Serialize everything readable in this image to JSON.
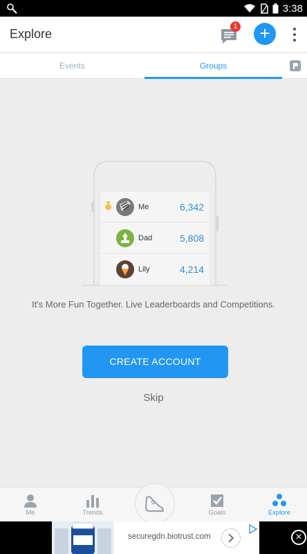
{
  "statusbar": {
    "time": "3:38"
  },
  "appbar": {
    "title": "Explore",
    "message_badge": "1",
    "add_label": "+"
  },
  "tabs": [
    {
      "label": "Events"
    },
    {
      "label": "Groups"
    }
  ],
  "illustration": {
    "leaderboard": [
      {
        "name": "Me",
        "score": "6,342",
        "icon": "zebra-avatar-icon",
        "medal": true
      },
      {
        "name": "Dad",
        "score": "5,808",
        "icon": "chess-pawn-avatar-icon",
        "medal": false
      },
      {
        "name": "Lily",
        "score": "4,214",
        "icon": "ice-cream-avatar-icon",
        "medal": false
      }
    ]
  },
  "tagline": "It's More Fun Together. Live Leaderboards and Competitions.",
  "create_account": "CREATE ACCOUNT",
  "skip": "Skip",
  "bottom_nav": {
    "items": [
      {
        "label": "Me",
        "icon": "person-icon",
        "active": false
      },
      {
        "label": "Trends",
        "icon": "bar-chart-icon",
        "active": false
      },
      {
        "label": "",
        "icon": "shoe-icon",
        "active": false
      },
      {
        "label": "Goals",
        "icon": "checkbox-icon",
        "active": false
      },
      {
        "label": "Explore",
        "icon": "group-icon",
        "active": true
      }
    ]
  },
  "ad": {
    "url": "securegdn.biotrust.com",
    "close": "×"
  },
  "colors": {
    "accent": "#2196f3",
    "badge": "#e53935",
    "score": "#2a8fd1"
  }
}
